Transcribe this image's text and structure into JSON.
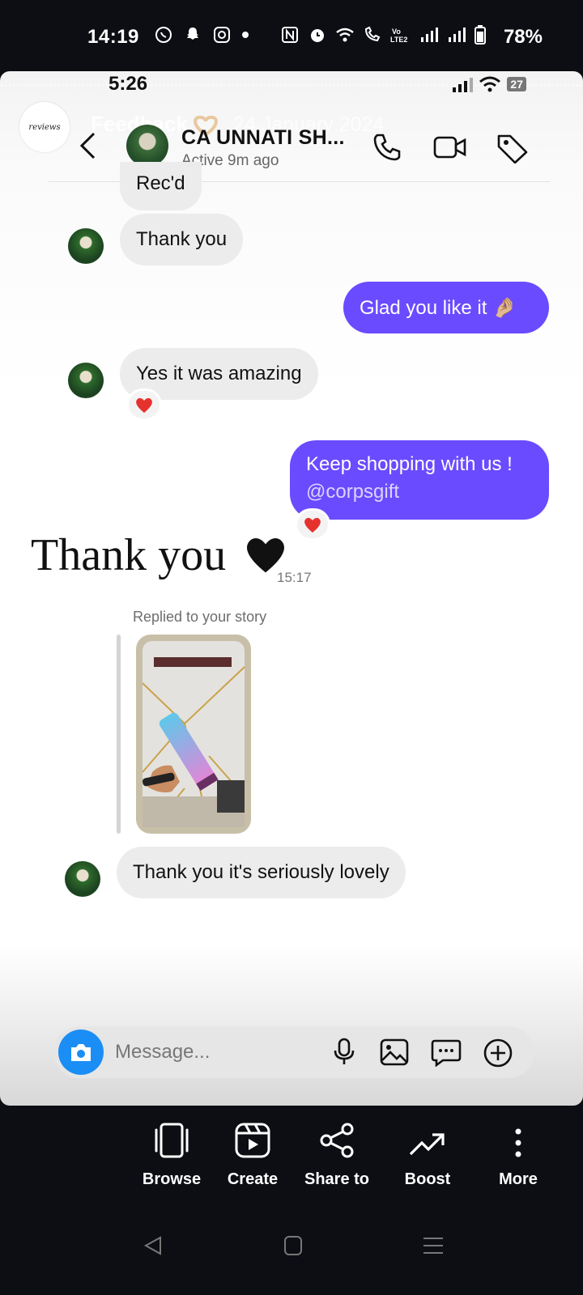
{
  "status_bar": {
    "time": "14:19",
    "battery": "78%"
  },
  "story": {
    "inner_time": "5:26",
    "inner_battery": "27",
    "avatar_text": "reviews",
    "title": "Feedback",
    "date": "24 January 2024"
  },
  "chat": {
    "contact_name": "CA UNNATI SH...",
    "contact_status": "Active 9m ago",
    "messages": {
      "partial": "Rec'd",
      "thank_you": "Thank you",
      "glad": "Glad you like it 🤌🏼",
      "amazing": "Yes it was amazing",
      "keep_shopping_1": "Keep shopping with us !",
      "keep_shopping_2": "@corpsgift",
      "big_thanks": "Thank you",
      "big_time": "15:17",
      "replied_label": "Replied to your story",
      "lovely": "Thank you it's seriously lovely"
    },
    "composer_placeholder": "Message..."
  },
  "actions": [
    {
      "label": "Browse",
      "icon": "browse-icon"
    },
    {
      "label": "Create",
      "icon": "create-reel-icon"
    },
    {
      "label": "Share to",
      "icon": "share-icon"
    },
    {
      "label": "Boost",
      "icon": "boost-trend-icon"
    },
    {
      "label": "More",
      "icon": "more-vertical-icon"
    }
  ],
  "colors": {
    "outgoing_bubble": "#6b4bff",
    "incoming_bubble": "#ececec",
    "camera_button": "#1a8ef5",
    "heart_reaction": "#e5322d"
  }
}
